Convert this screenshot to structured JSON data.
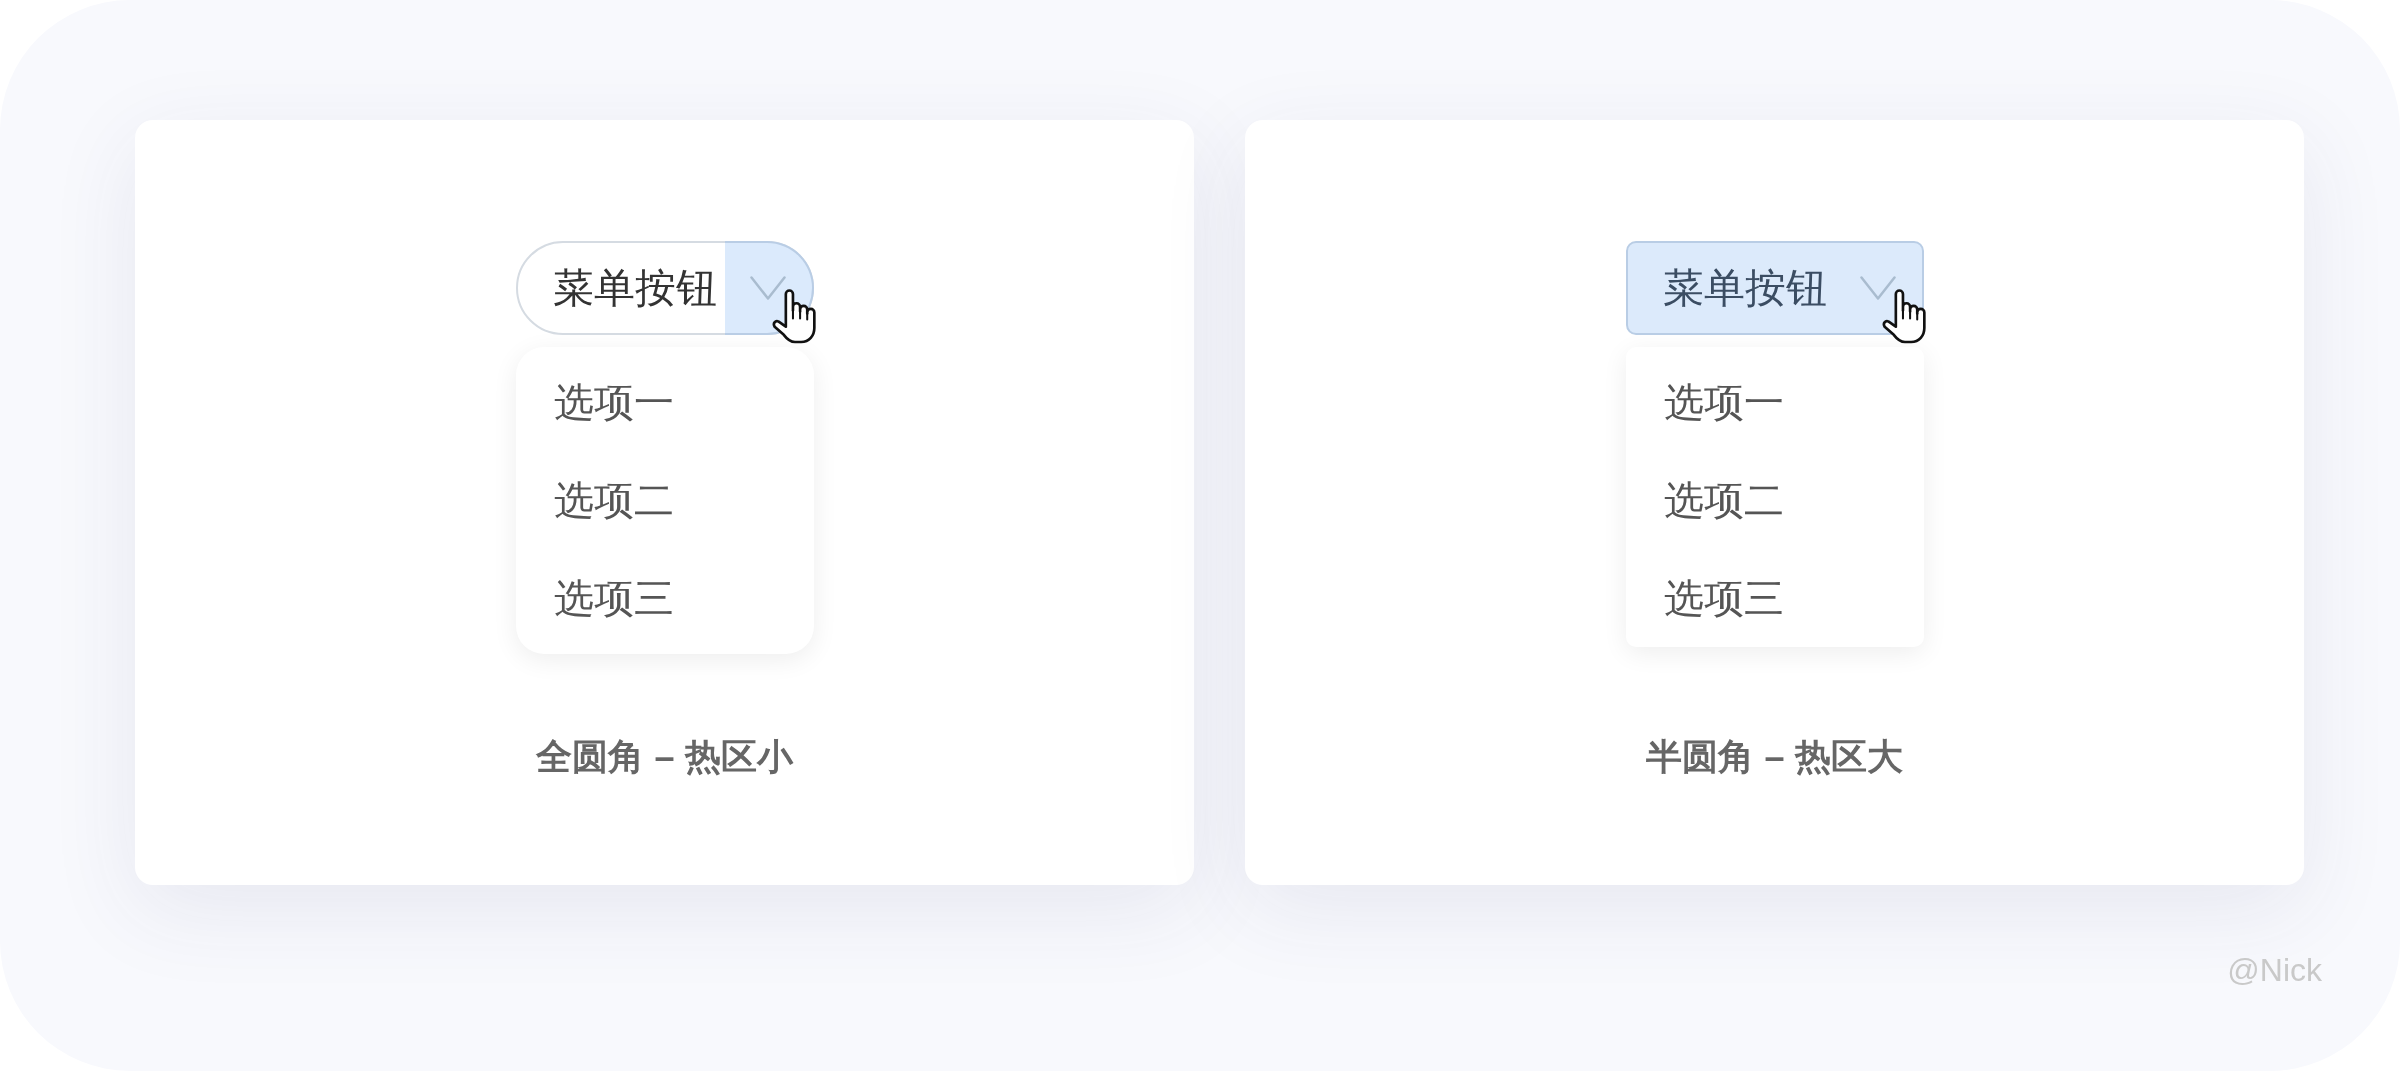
{
  "demos": [
    {
      "kind": "pill",
      "button": {
        "label": "菜单按钮"
      },
      "options": [
        "选项一",
        "选项二",
        "选项三"
      ],
      "caption": "全圆角 – 热区小"
    },
    {
      "kind": "rounded",
      "button": {
        "label": "菜单按钮"
      },
      "options": [
        "选项一",
        "选项二",
        "选项三"
      ],
      "caption": "半圆角 – 热区大"
    }
  ],
  "signature": "@Nick"
}
